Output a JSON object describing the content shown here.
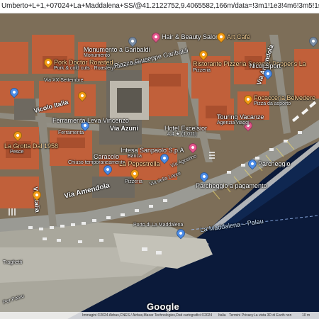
{
  "browser": {
    "url": "Umberto+L+1,+07024+La+Maddalena+SS/@41.2122752,9.4065582,166m/data=!3m1!1e3!4m6!3m5!1s0x12d94281b055399d:0x6f..."
  },
  "map": {
    "roads": {
      "via_amendola": "Via Amendola",
      "via_azuni": "Via Azuni",
      "vicolo_italia": "Vicolo Italia",
      "via_italia": "Via Italia",
      "via_amendola_upper": "Via Amendola",
      "via_xx_settembre": "Via XX Settembre",
      "via_della_lepre": "Via della Lepre",
      "via_agostino": "Via Agostino",
      "piazza_garibaldi": "Piazza Garibaldi",
      "porto": "Porto di La Maddalena",
      "traghetti": "Traghetti",
      "per_palau": "Per Palau",
      "maddalena_palau": "La Maddalena – Palau"
    },
    "places": [
      {
        "label": "Hair & Beauty Salone",
        "color": "pink"
      },
      {
        "label": "Art Café",
        "color": "orange"
      },
      {
        "label": "Monumento a Garibaldi",
        "color": "gray"
      },
      {
        "label": "Piazza Giuseppe Garibaldi",
        "color": "gray"
      },
      {
        "label": "Ristorante Pizzeria Sergent Pepper's La",
        "color": "orange"
      },
      {
        "label": "Nicol Sport",
        "color": "blue"
      },
      {
        "label": "Pork Doctor Roasted",
        "color": "orange"
      },
      {
        "label": "Focacceria Belvedere",
        "color": "orange"
      },
      {
        "label": "Touring Vacanze",
        "color": "pink"
      },
      {
        "label": "Ferramenta Leva Vincenzo",
        "color": "blue"
      },
      {
        "label": "La Grotta Dal 1958",
        "color": "orange"
      },
      {
        "label": "Hotel Excelsior",
        "color": "pink"
      },
      {
        "label": "Intesa Sanpaolo S.p.A",
        "color": "blue"
      },
      {
        "label": "Caracolo",
        "color": "blue"
      },
      {
        "label": "La Pepestrella",
        "color": "orange"
      },
      {
        "label": "Parcheggio",
        "color": "blue"
      },
      {
        "label": "Parcheggio a pagamento",
        "color": "blue"
      }
    ],
    "sublabels": {
      "pork": "Pork & cold cuts · Roastery",
      "ferramenta": "Ferramenta",
      "grotta": "Pesce",
      "caracolo": "Chiuso temporaneamente",
      "pepestrella": "Pizzeria",
      "hotel": "4.4 ★ (1,011)",
      "focacceria": "Pizza da asporto",
      "touring": "Agenzia viaggi",
      "sergent": "Pizzeria",
      "monumento": "Monumento",
      "intesa": "Banca"
    }
  },
  "branding": {
    "logo": "Google"
  },
  "footer": {
    "imagery": "Immagini ©2024 Airbus,CNES / Airbus,Maxar Technologies,Dati cartografici ©2024",
    "italia": "Italia",
    "terms": "Termini",
    "privacy": "Privacy",
    "feedback": "Invia feedback sul prodotto",
    "view3d": "La vista 3D di Earth non",
    "scale": "10 m"
  },
  "colors": {
    "sea": "#0b1a3a",
    "rooftop": "#c1603a",
    "road": "#9a9a94",
    "quay": "#b8b6ad"
  }
}
